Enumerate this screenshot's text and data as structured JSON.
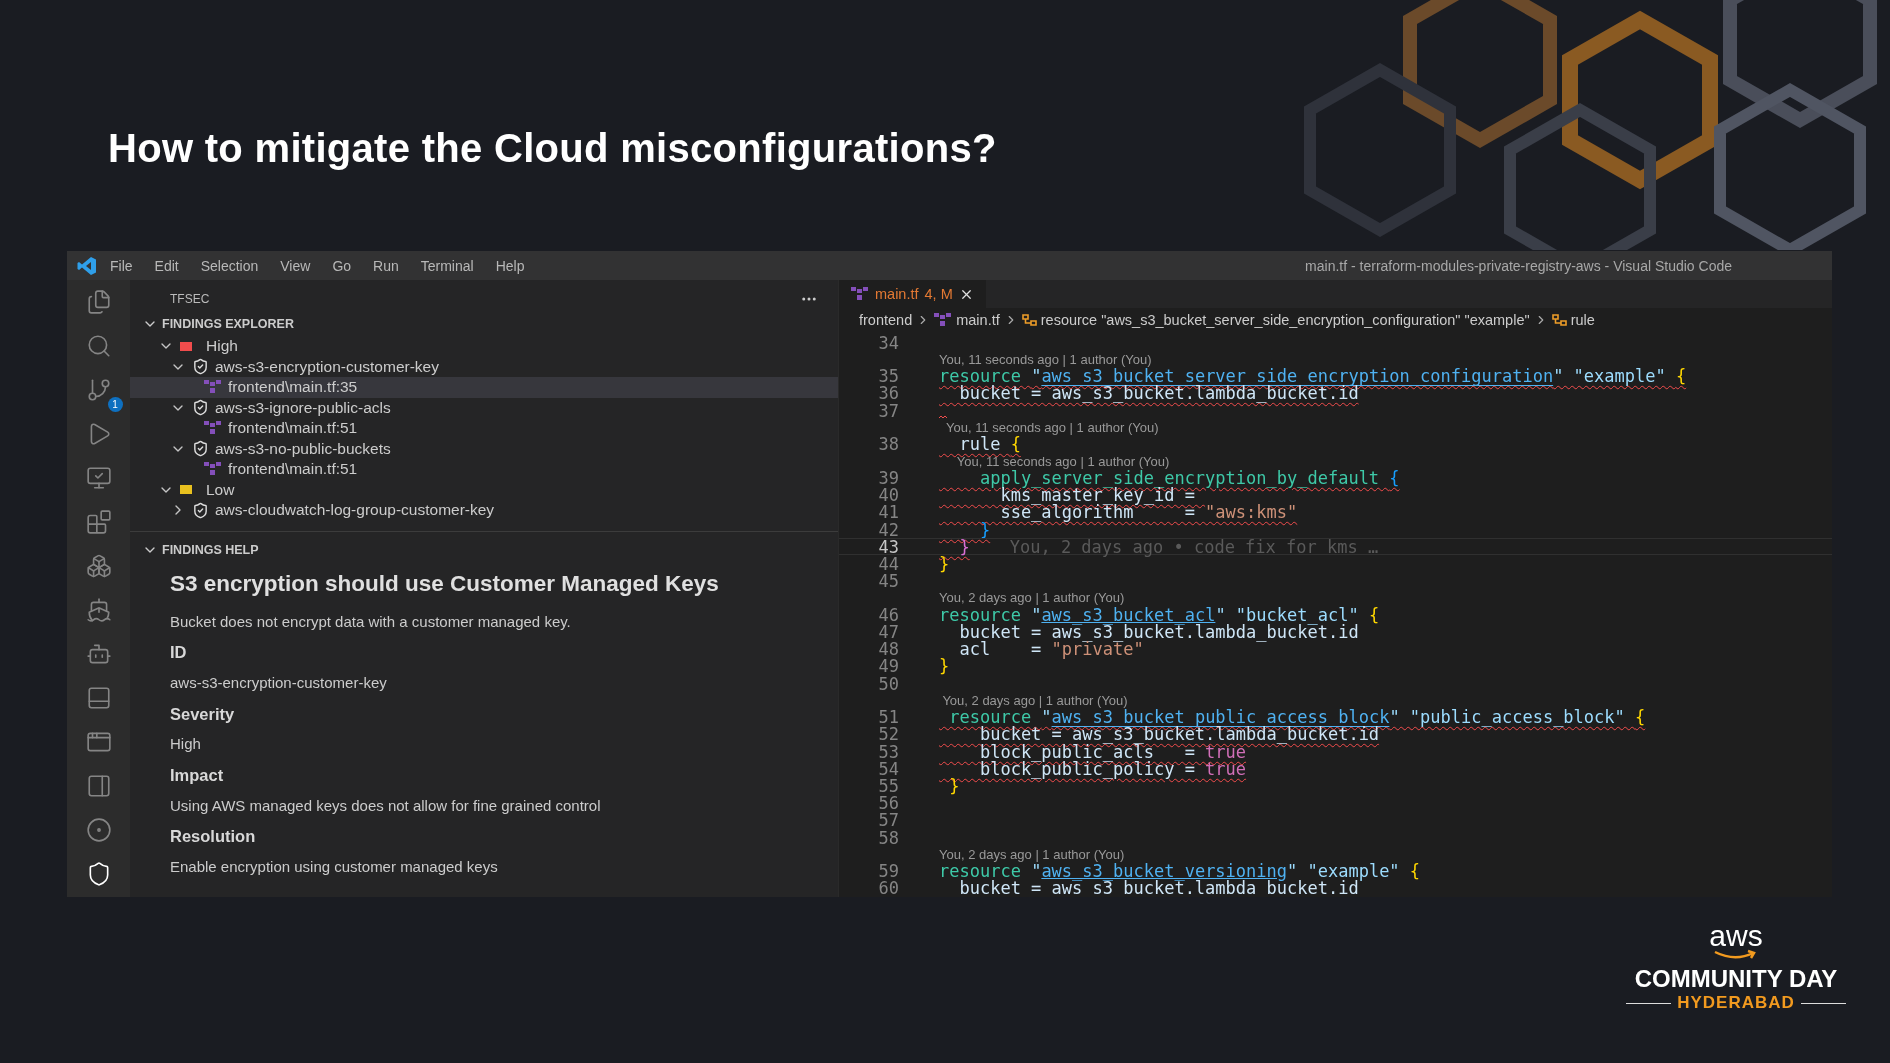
{
  "slide": {
    "title": "How to mitigate the Cloud misconfigurations?"
  },
  "window": {
    "title": "main.tf - terraform-modules-private-registry-aws - Visual Studio Code",
    "menu": [
      "File",
      "Edit",
      "Selection",
      "View",
      "Go",
      "Run",
      "Terminal",
      "Help"
    ]
  },
  "activity_bar": {
    "items": [
      {
        "selected": false
      },
      {
        "selected": false
      },
      {
        "selected": false,
        "badge": "1"
      },
      {
        "selected": false
      },
      {
        "selected": false
      },
      {
        "selected": false
      },
      {
        "selected": false
      },
      {
        "selected": false
      },
      {
        "selected": false
      },
      {
        "selected": false
      },
      {
        "selected": false
      },
      {
        "selected": false
      },
      {
        "selected": false
      },
      {
        "selected": true
      }
    ]
  },
  "sidebar": {
    "title": "TFSEC",
    "findings_explorer": {
      "title": "FINDINGS EXPLORER",
      "expanded": true,
      "items": [
        {
          "kind": "severity",
          "label": "High",
          "color": "#f14c4c",
          "expanded": true,
          "selected": false,
          "children": [
            {
              "kind": "finding",
              "label": "aws-s3-encryption-customer-key",
              "expanded": true,
              "selected": false,
              "children": [
                {
                  "kind": "file",
                  "label": "frontend\\main.tf:35",
                  "selected": true
                }
              ]
            },
            {
              "kind": "finding",
              "label": "aws-s3-ignore-public-acls",
              "expanded": true,
              "selected": false,
              "children": [
                {
                  "kind": "file",
                  "label": "frontend\\main.tf:51",
                  "selected": false
                }
              ]
            },
            {
              "kind": "finding",
              "label": "aws-s3-no-public-buckets",
              "expanded": true,
              "selected": false,
              "children": [
                {
                  "kind": "file",
                  "label": "frontend\\main.tf:51",
                  "selected": false
                }
              ]
            }
          ]
        },
        {
          "kind": "severity",
          "label": "Low",
          "color": "#e8c01f",
          "expanded": true,
          "selected": false,
          "children": [
            {
              "kind": "finding",
              "label": "aws-cloudwatch-log-group-customer-key",
              "expanded": false,
              "selected": false
            }
          ]
        }
      ]
    },
    "findings_help": {
      "title": "FINDINGS HELP",
      "expanded": true,
      "heading": "S3 encryption should use Customer Managed Keys",
      "description": "Bucket does not encrypt data with a customer managed key.",
      "sections": [
        {
          "label": "ID",
          "value": "aws-s3-encryption-customer-key"
        },
        {
          "label": "Severity",
          "value": "High"
        },
        {
          "label": "Impact",
          "value": "Using AWS managed keys does not allow for fine grained control"
        },
        {
          "label": "Resolution",
          "value": "Enable encryption using customer managed keys"
        }
      ]
    }
  },
  "editor": {
    "tabs": [
      {
        "label": "main.tf",
        "badge": "4, M",
        "selected": true
      }
    ],
    "breadcrumb": [
      {
        "kind": "folder",
        "label": "frontend"
      },
      {
        "kind": "file",
        "label": "main.tf"
      },
      {
        "kind": "symbol",
        "label": "resource \"aws_s3_bucket_server_side_encryption_configuration\" \"example\""
      },
      {
        "kind": "symbol",
        "label": "rule"
      }
    ],
    "lines": [
      {
        "kind": "code",
        "number": "34"
      },
      {
        "kind": "lens",
        "text": "You, 11 seconds ago | 1 author (You)"
      },
      {
        "kind": "code",
        "number": "35",
        "error": true,
        "parts": [
          {
            "kind": "kw",
            "text": "resource "
          },
          {
            "kind": "str",
            "text": "\""
          },
          {
            "kind": "link",
            "text": "aws_s3_bucket_server_side_encryption_configuration"
          },
          {
            "kind": "str",
            "text": "\" \"example\" "
          },
          {
            "kind": "brace",
            "text": "{"
          }
        ]
      },
      {
        "kind": "code",
        "number": "36",
        "error": true,
        "parts": [
          {
            "kind": "ident",
            "text": "  bucket = aws_s3_bucket.lambda_bucket.id"
          }
        ]
      },
      {
        "kind": "code",
        "number": "37",
        "error": true
      },
      {
        "kind": "lens",
        "text": "  You, 11 seconds ago | 1 author (You)"
      },
      {
        "kind": "code",
        "number": "38",
        "error": true,
        "parts": [
          {
            "kind": "ident",
            "text": "  rule "
          },
          {
            "kind": "brace",
            "text": "{"
          }
        ]
      },
      {
        "kind": "lens",
        "text": "     You, 11 seconds ago | 1 author (You)"
      },
      {
        "kind": "code",
        "number": "39",
        "error": true,
        "parts": [
          {
            "kind": "kw",
            "text": "    apply_server_side_encryption_by_default "
          },
          {
            "kind": "brace2",
            "text": "{"
          }
        ]
      },
      {
        "kind": "code",
        "number": "40",
        "error": true,
        "parts": [
          {
            "kind": "ident",
            "text": "      kms_master_key_id = "
          }
        ]
      },
      {
        "kind": "code",
        "number": "41",
        "error": true,
        "parts": [
          {
            "kind": "ident",
            "text": "      sse_algorithm     = "
          },
          {
            "kind": "val",
            "text": "\"aws:kms\""
          }
        ]
      },
      {
        "kind": "code",
        "number": "42",
        "error": true,
        "parts": [
          {
            "kind": "brace2",
            "text": "    }"
          }
        ]
      },
      {
        "kind": "code",
        "number": "43",
        "error": true,
        "current": true,
        "parts": [
          {
            "kind": "brace3",
            "text": "  }"
          }
        ],
        "ghost": "You, 2 days ago • code fix for kms …"
      },
      {
        "kind": "code",
        "number": "44",
        "parts": [
          {
            "kind": "brace",
            "text": "}"
          }
        ]
      },
      {
        "kind": "code",
        "number": "45"
      },
      {
        "kind": "lens",
        "text": "You, 2 days ago | 1 author (You)"
      },
      {
        "kind": "code",
        "number": "46",
        "parts": [
          {
            "kind": "kw",
            "text": "resource "
          },
          {
            "kind": "str",
            "text": "\""
          },
          {
            "kind": "link",
            "text": "aws_s3_bucket_acl"
          },
          {
            "kind": "str",
            "text": "\" \"bucket_acl\" "
          },
          {
            "kind": "brace",
            "text": "{"
          }
        ]
      },
      {
        "kind": "code",
        "number": "47",
        "parts": [
          {
            "kind": "ident",
            "text": "  bucket = aws_s3_bucket.lambda_bucket.id"
          }
        ]
      },
      {
        "kind": "code",
        "number": "48",
        "parts": [
          {
            "kind": "ident",
            "text": "  acl    = "
          },
          {
            "kind": "val",
            "text": "\"private\""
          }
        ]
      },
      {
        "kind": "code",
        "number": "49",
        "parts": [
          {
            "kind": "brace",
            "text": "}"
          }
        ]
      },
      {
        "kind": "code",
        "number": "50"
      },
      {
        "kind": "lens",
        "text": " You, 2 days ago | 1 author (You)"
      },
      {
        "kind": "code",
        "number": "51",
        "error": true,
        "parts": [
          {
            "kind": "kw",
            "text": " resource "
          },
          {
            "kind": "str",
            "text": "\""
          },
          {
            "kind": "link",
            "text": "aws_s3_bucket_public_access_block"
          },
          {
            "kind": "str",
            "text": "\" \"public_access_block\" "
          },
          {
            "kind": "brace",
            "text": "{"
          }
        ]
      },
      {
        "kind": "code",
        "number": "52",
        "error": true,
        "parts": [
          {
            "kind": "ident",
            "text": "    bucket = aws_s3_bucket.lambda_bucket.id"
          }
        ]
      },
      {
        "kind": "code",
        "number": "53",
        "error": true,
        "parts": [
          {
            "kind": "ident",
            "text": "    block_public_acls   = "
          },
          {
            "kind": "bool",
            "text": "true"
          }
        ]
      },
      {
        "kind": "code",
        "number": "54",
        "error": true,
        "parts": [
          {
            "kind": "ident",
            "text": "    block_public_policy = "
          },
          {
            "kind": "bool",
            "text": "true"
          }
        ]
      },
      {
        "kind": "code",
        "number": "55",
        "parts": [
          {
            "kind": "brace",
            "text": " }"
          }
        ]
      },
      {
        "kind": "code",
        "number": "56"
      },
      {
        "kind": "code",
        "number": "57"
      },
      {
        "kind": "code",
        "number": "58"
      },
      {
        "kind": "lens",
        "text": "You, 2 days ago | 1 author (You)"
      },
      {
        "kind": "code",
        "number": "59",
        "parts": [
          {
            "kind": "kw",
            "text": "resource "
          },
          {
            "kind": "str",
            "text": "\""
          },
          {
            "kind": "link",
            "text": "aws_s3_bucket_versioning"
          },
          {
            "kind": "str",
            "text": "\" \"example\" "
          },
          {
            "kind": "brace",
            "text": "{"
          }
        ]
      },
      {
        "kind": "code",
        "number": "60",
        "parts": [
          {
            "kind": "ident",
            "text": "  bucket = aws_s3_bucket.lambda_bucket.id"
          }
        ]
      }
    ]
  },
  "logo": {
    "mark": "aws",
    "title": "COMMUNITY DAY",
    "subtitle": "HYDERABAD"
  }
}
